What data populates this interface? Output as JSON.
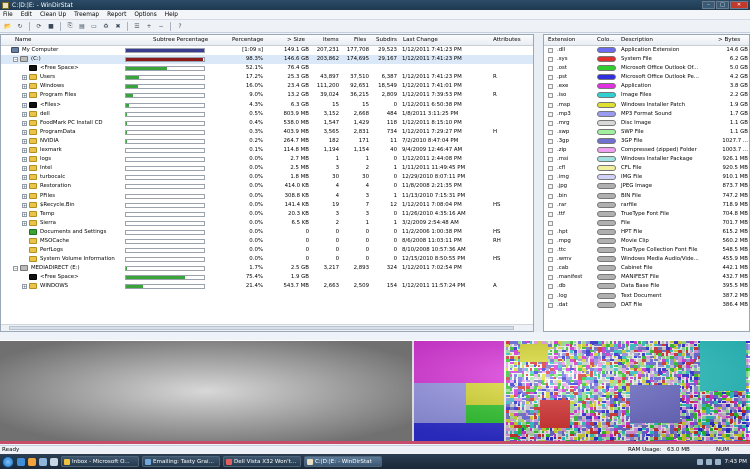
{
  "window": {
    "title": "C:|D:|E: - WinDirStat"
  },
  "menu": [
    "File",
    "Edit",
    "Clean Up",
    "Treemap",
    "Report",
    "Options",
    "Help"
  ],
  "toolbar_icons": [
    "open-icon",
    "refresh-icon",
    "refresh-all-icon",
    "stop-icon",
    "copy-icon",
    "explorer-icon",
    "cmd-icon",
    "recycle-icon",
    "delete-icon",
    "properties-icon",
    "zoom-in-icon",
    "zoom-out-icon",
    "help-icon"
  ],
  "tree": {
    "columns": {
      "name": "Name",
      "subtree": "Subtree Percentage",
      "percentage": "Percentage",
      "size": "> Size",
      "items": "Items",
      "files": "Files",
      "subdirs": "Subdirs",
      "last_change": "Last Change",
      "attributes": "Attributes"
    },
    "rows": [
      {
        "name": "My Computer",
        "indent": 0,
        "icon": "pc",
        "exp": "",
        "subtree": 1.0,
        "bar_color": "#3b3b8f",
        "pct": "[1:09 s]",
        "size": "149.1 GB",
        "items": "207,231",
        "files": "177,708",
        "subdirs": "29,523",
        "last": "1/12/2011  7:41:23 PM",
        "attr": ""
      },
      {
        "name": "(C:)",
        "indent": 1,
        "icon": "drv",
        "exp": "−",
        "subtree": 0.983,
        "bar_color": "#8b1a1a",
        "pct": "98.3%",
        "size": "146.6 GB",
        "items": "203,862",
        "files": "174,695",
        "subdirs": "29,167",
        "last": "1/12/2011  7:41:23 PM",
        "attr": "",
        "sel": true
      },
      {
        "name": "<Free Space>",
        "indent": 2,
        "icon": "blk",
        "exp": "",
        "subtree": 0.521,
        "bar_color": "#3aa33a",
        "pct": "52.1%",
        "size": "76.4 GB",
        "items": "",
        "files": "",
        "subdirs": "",
        "last": "",
        "attr": ""
      },
      {
        "name": "Users",
        "indent": 2,
        "icon": "fold",
        "exp": "+",
        "subtree": 0.172,
        "bar_color": "#3aa33a",
        "pct": "17.2%",
        "size": "25.3 GB",
        "items": "43,897",
        "files": "37,510",
        "subdirs": "6,387",
        "last": "1/12/2011  7:41:23 PM",
        "attr": "R"
      },
      {
        "name": "Windows",
        "indent": 2,
        "icon": "fold",
        "exp": "+",
        "subtree": 0.16,
        "bar_color": "#3aa33a",
        "pct": "16.0%",
        "size": "23.4 GB",
        "items": "111,200",
        "files": "92,651",
        "subdirs": "18,549",
        "last": "1/12/2011  7:41:01 PM",
        "attr": ""
      },
      {
        "name": "Program Files",
        "indent": 2,
        "icon": "fold",
        "exp": "+",
        "subtree": 0.09,
        "bar_color": "#3aa33a",
        "pct": "9.0%",
        "size": "13.2 GB",
        "items": "39,024",
        "files": "36,215",
        "subdirs": "2,809",
        "last": "1/12/2011  7:39:53 PM",
        "attr": "R"
      },
      {
        "name": "<Files>",
        "indent": 2,
        "icon": "blk",
        "exp": "+",
        "subtree": 0.043,
        "bar_color": "#3aa33a",
        "pct": "4.3%",
        "size": "6.3 GB",
        "items": "15",
        "files": "15",
        "subdirs": "0",
        "last": "1/12/2011  6:50:38 PM",
        "attr": ""
      },
      {
        "name": "dell",
        "indent": 2,
        "icon": "fold",
        "exp": "+",
        "subtree": 0.005,
        "bar_color": "#3aa33a",
        "pct": "0.5%",
        "size": "803.9 MB",
        "items": "3,152",
        "files": "2,668",
        "subdirs": "484",
        "last": "1/8/2011  3:11:25 PM",
        "attr": ""
      },
      {
        "name": "FoodMark PC Install CD",
        "indent": 2,
        "icon": "fold",
        "exp": "+",
        "subtree": 0.004,
        "bar_color": "#3aa33a",
        "pct": "0.4%",
        "size": "538.0 MB",
        "items": "1,547",
        "files": "1,429",
        "subdirs": "118",
        "last": "1/12/2011  8:15:10 PM",
        "attr": ""
      },
      {
        "name": "ProgramData",
        "indent": 2,
        "icon": "fold",
        "exp": "+",
        "subtree": 0.003,
        "bar_color": "#3aa33a",
        "pct": "0.3%",
        "size": "403.9 MB",
        "items": "3,565",
        "files": "2,831",
        "subdirs": "734",
        "last": "1/12/2011  7:29:27 PM",
        "attr": "H"
      },
      {
        "name": "NVIDIA",
        "indent": 2,
        "icon": "fold",
        "exp": "+",
        "subtree": 0.002,
        "bar_color": "#3aa33a",
        "pct": "0.2%",
        "size": "264.7 MB",
        "items": "182",
        "files": "171",
        "subdirs": "11",
        "last": "7/2/2010  8:47:04 PM",
        "attr": ""
      },
      {
        "name": "lexmark",
        "indent": 2,
        "icon": "fold",
        "exp": "+",
        "subtree": 0.001,
        "bar_color": "#3aa33a",
        "pct": "0.1%",
        "size": "114.8 MB",
        "items": "1,194",
        "files": "1,154",
        "subdirs": "40",
        "last": "9/4/2009  12:46:47 AM",
        "attr": ""
      },
      {
        "name": "logs",
        "indent": 2,
        "icon": "fold",
        "exp": "+",
        "subtree": 0.0,
        "bar_color": "#3aa33a",
        "pct": "0.0%",
        "size": "2.7 MB",
        "items": "1",
        "files": "1",
        "subdirs": "0",
        "last": "1/12/2011  2:44:08 PM",
        "attr": ""
      },
      {
        "name": "Intel",
        "indent": 2,
        "icon": "fold",
        "exp": "+",
        "subtree": 0.0,
        "bar_color": "#3aa33a",
        "pct": "0.0%",
        "size": "2.5 MB",
        "items": "3",
        "files": "2",
        "subdirs": "1",
        "last": "1/11/2011  11:49:45 PM",
        "attr": ""
      },
      {
        "name": "turbocalc",
        "indent": 2,
        "icon": "fold",
        "exp": "+",
        "subtree": 0.0,
        "bar_color": "#3aa33a",
        "pct": "0.0%",
        "size": "1.8 MB",
        "items": "30",
        "files": "30",
        "subdirs": "0",
        "last": "12/29/2010  8:07:11 PM",
        "attr": ""
      },
      {
        "name": "Restoration",
        "indent": 2,
        "icon": "fold",
        "exp": "+",
        "subtree": 0.0,
        "bar_color": "#3aa33a",
        "pct": "0.0%",
        "size": "414.0 KB",
        "items": "4",
        "files": "4",
        "subdirs": "0",
        "last": "11/8/2008  2:21:35 PM",
        "attr": ""
      },
      {
        "name": "PFiles",
        "indent": 2,
        "icon": "fold",
        "exp": "+",
        "subtree": 0.0,
        "bar_color": "#3aa33a",
        "pct": "0.0%",
        "size": "308.8 KB",
        "items": "4",
        "files": "3",
        "subdirs": "1",
        "last": "11/13/2010  7:15:31 PM",
        "attr": ""
      },
      {
        "name": "$Recycle.Bin",
        "indent": 2,
        "icon": "fold",
        "exp": "+",
        "subtree": 0.0,
        "bar_color": "#3aa33a",
        "pct": "0.0%",
        "size": "141.4 KB",
        "items": "19",
        "files": "7",
        "subdirs": "12",
        "last": "1/12/2011  7:08:04 PM",
        "attr": "HS"
      },
      {
        "name": "Temp",
        "indent": 2,
        "icon": "fold",
        "exp": "+",
        "subtree": 0.0,
        "bar_color": "#3aa33a",
        "pct": "0.0%",
        "size": "20.3 KB",
        "items": "3",
        "files": "3",
        "subdirs": "0",
        "last": "11/26/2010  4:35:16 AM",
        "attr": ""
      },
      {
        "name": "Sierra",
        "indent": 2,
        "icon": "fold",
        "exp": "+",
        "subtree": 0.0,
        "bar_color": "#3aa33a",
        "pct": "0.0%",
        "size": "6.5 KB",
        "items": "2",
        "files": "1",
        "subdirs": "1",
        "last": "3/2/2009  2:54:48 AM",
        "attr": ""
      },
      {
        "name": "Documents and Settings",
        "indent": 2,
        "icon": "grn",
        "exp": "",
        "subtree": 0.0,
        "bar_color": "#3aa33a",
        "pct": "0.0%",
        "size": "0",
        "items": "0",
        "files": "0",
        "subdirs": "0",
        "last": "11/2/2006  1:00:38 PM",
        "attr": "HS"
      },
      {
        "name": "MSOCache",
        "indent": 2,
        "icon": "fold",
        "exp": "",
        "subtree": 0.0,
        "bar_color": "#3aa33a",
        "pct": "0.0%",
        "size": "0",
        "items": "0",
        "files": "0",
        "subdirs": "0",
        "last": "8/6/2008  11:03:11 PM",
        "attr": "RH"
      },
      {
        "name": "PerfLogs",
        "indent": 2,
        "icon": "fold",
        "exp": "",
        "subtree": 0.0,
        "bar_color": "#3aa33a",
        "pct": "0.0%",
        "size": "0",
        "items": "0",
        "files": "0",
        "subdirs": "0",
        "last": "8/10/2008  10:57:36 AM",
        "attr": ""
      },
      {
        "name": "System Volume Information",
        "indent": 2,
        "icon": "fold",
        "exp": "",
        "subtree": 0.0,
        "bar_color": "#3aa33a",
        "pct": "0.0%",
        "size": "0",
        "items": "0",
        "files": "0",
        "subdirs": "0",
        "last": "12/15/2010  8:50:55 PM",
        "attr": "HS"
      },
      {
        "name": "MEDIADIRECT (E:)",
        "indent": 1,
        "icon": "drv",
        "exp": "−",
        "subtree": 0.017,
        "bar_color": "#3aa33a",
        "pct": "1.7%",
        "size": "2.5 GB",
        "items": "3,217",
        "files": "2,893",
        "subdirs": "324",
        "last": "1/12/2011  7:02:54 PM",
        "attr": ""
      },
      {
        "name": "<Free Space>",
        "indent": 2,
        "icon": "blk",
        "exp": "",
        "subtree": 0.754,
        "bar_color": "#3aa33a",
        "pct": "75.4%",
        "size": "1.9 GB",
        "items": "",
        "files": "",
        "subdirs": "",
        "last": "",
        "attr": ""
      },
      {
        "name": "WINDOWS",
        "indent": 2,
        "icon": "fold",
        "exp": "+",
        "subtree": 0.214,
        "bar_color": "#3aa33a",
        "pct": "21.4%",
        "size": "543.7 MB",
        "items": "2,663",
        "files": "2,509",
        "subdirs": "154",
        "last": "1/12/2011  11:57:24 PM",
        "attr": "A"
      }
    ]
  },
  "extensions": {
    "columns": {
      "ext": "Extension",
      "color": "Colo...",
      "desc": "Description",
      "bytes": "> Bytes"
    },
    "rows": [
      {
        "ext": ".dll",
        "color": "#6c6cf0",
        "desc": "Application Extension",
        "bytes": "14.6 GB"
      },
      {
        "ext": ".sys",
        "color": "#e03030",
        "desc": "System File",
        "bytes": "6.2 GB"
      },
      {
        "ext": ".ost",
        "color": "#2ecf2e",
        "desc": "Microsoft Office Outlook Of...",
        "bytes": "5.0 GB"
      },
      {
        "ext": ".pst",
        "color": "#3030e0",
        "desc": "Microsoft Office Outlook Pe...",
        "bytes": "4.2 GB"
      },
      {
        "ext": ".exe",
        "color": "#e030e0",
        "desc": "Application",
        "bytes": "3.8 GB"
      },
      {
        "ext": ".iso",
        "color": "#30d0d0",
        "desc": "Image Files",
        "bytes": "2.2 GB"
      },
      {
        "ext": ".msp",
        "color": "#e0e030",
        "desc": "Windows Installer Patch",
        "bytes": "1.9 GB"
      },
      {
        "ext": ".mp3",
        "color": "#9a9af0",
        "desc": "MP3 Format Sound",
        "bytes": "1.7 GB"
      },
      {
        "ext": ".mrg",
        "color": "#d8d8d8",
        "desc": "Disc Image",
        "bytes": "1.1 GB"
      },
      {
        "ext": ".swp",
        "color": "#a0f0a0",
        "desc": "SWP File",
        "bytes": "1.1 GB"
      },
      {
        "ext": ".3gp",
        "color": "#7070d0",
        "desc": "3GP File",
        "bytes": "1027.7 ..."
      },
      {
        "ext": ".zip",
        "color": "#f0a0f0",
        "desc": "Compressed (zipped) Folder",
        "bytes": "1003.7 ..."
      },
      {
        "ext": ".msi",
        "color": "#a0e0e0",
        "desc": "Windows Installer Package",
        "bytes": "926.1 MB"
      },
      {
        "ext": ".cfl",
        "color": "#f0f0a0",
        "desc": "CFL File",
        "bytes": "920.5 MB"
      },
      {
        "ext": ".img",
        "color": "#d0d0f8",
        "desc": "IMG File",
        "bytes": "910.1 MB"
      },
      {
        "ext": ".jpg",
        "color": "#b0b0b0",
        "desc": "JPEG Image",
        "bytes": "873.7 MB"
      },
      {
        "ext": ".bin",
        "color": "#b0b0b0",
        "desc": "BIN File",
        "bytes": "747.2 MB"
      },
      {
        "ext": ".rar",
        "color": "#b0b0b0",
        "desc": "rarfile",
        "bytes": "718.9 MB"
      },
      {
        "ext": ".ttf",
        "color": "#b0b0b0",
        "desc": "TrueType Font File",
        "bytes": "704.8 MB"
      },
      {
        "ext": "",
        "color": "#b0b0b0",
        "desc": "File",
        "bytes": "701.7 MB"
      },
      {
        "ext": ".hpt",
        "color": "#b0b0b0",
        "desc": "HPT File",
        "bytes": "615.2 MB"
      },
      {
        "ext": ".mpg",
        "color": "#b0b0b0",
        "desc": "Movie Clip",
        "bytes": "560.2 MB"
      },
      {
        "ext": ".ttc",
        "color": "#b0b0b0",
        "desc": "TrueType Collection Font File",
        "bytes": "548.5 MB"
      },
      {
        "ext": ".wmv",
        "color": "#b0b0b0",
        "desc": "Windows Media Audio/Vide...",
        "bytes": "455.9 MB"
      },
      {
        "ext": ".cab",
        "color": "#b0b0b0",
        "desc": "Cabinet File",
        "bytes": "442.1 MB"
      },
      {
        "ext": ".manifest",
        "color": "#b0b0b0",
        "desc": "MANIFEST File",
        "bytes": "432.7 MB"
      },
      {
        "ext": ".db",
        "color": "#b0b0b0",
        "desc": "Data Base File",
        "bytes": "395.5 MB"
      },
      {
        "ext": ".log",
        "color": "#b0b0b0",
        "desc": "Text Document",
        "bytes": "387.2 MB"
      },
      {
        "ext": ".dat",
        "color": "#b0b0b0",
        "desc": "DAT File",
        "bytes": "386.4 MB"
      }
    ]
  },
  "status": {
    "left": "Ready",
    "ram_label": "RAM Usage:",
    "ram_value": "63.0 MB",
    "num": "NUM"
  },
  "taskbar": {
    "tasks": [
      {
        "label": "Inbox - Microsoft O...",
        "color": "#f0c040"
      },
      {
        "label": "Emailing: Tasty Grai...",
        "color": "#6fa8dc"
      },
      {
        "label": "Dell Vista X32 Won't...",
        "color": "#e06060"
      },
      {
        "label": "C:|D:|E: - WinDirStat",
        "color": "#e8e0c0",
        "active": true
      }
    ],
    "clock": "7:43 PM"
  }
}
